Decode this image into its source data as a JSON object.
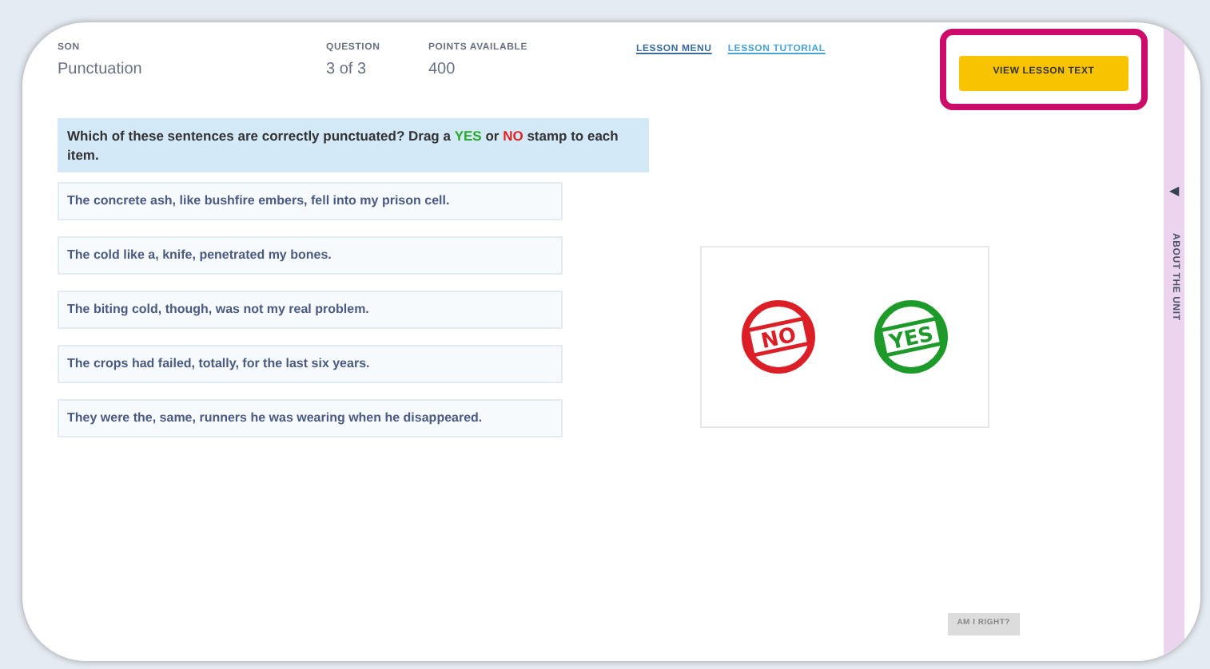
{
  "header": {
    "lesson": {
      "label": "SON",
      "value": "Punctuation"
    },
    "question": {
      "label": "QUESTION",
      "value": "3 of 3"
    },
    "points": {
      "label": "POINTS AVAILABLE",
      "value": "400"
    },
    "links": [
      "LESSON MENU",
      "LESSON TUTORIAL"
    ],
    "view_button": {
      "label": "VIEW LESSON TEXT",
      "highlighted": true
    }
  },
  "instruction": "Which of these sentences are correctly punctuated? Drag a **YES** or *NO* stamp to each item.",
  "items": [
    "The concrete ash, like bushfire embers, fell into my prison cell.",
    "The cold like a, knife, penetrated my bones.",
    "The biting cold, though, was not my real problem.",
    "The crops had failed, totally, for the last six years.",
    "They were the, same, runners he was wearing when he disappeared."
  ],
  "stamps": [
    {
      "label": "NO",
      "color": "#dc1f26"
    },
    {
      "label": "YES",
      "color": "#1e9a2a"
    }
  ],
  "submit_button": {
    "label": "AM I RIGHT?",
    "disabled": true
  },
  "side_panel": {
    "arrow": "◀",
    "label": "ABOUT THE UNIT"
  }
}
